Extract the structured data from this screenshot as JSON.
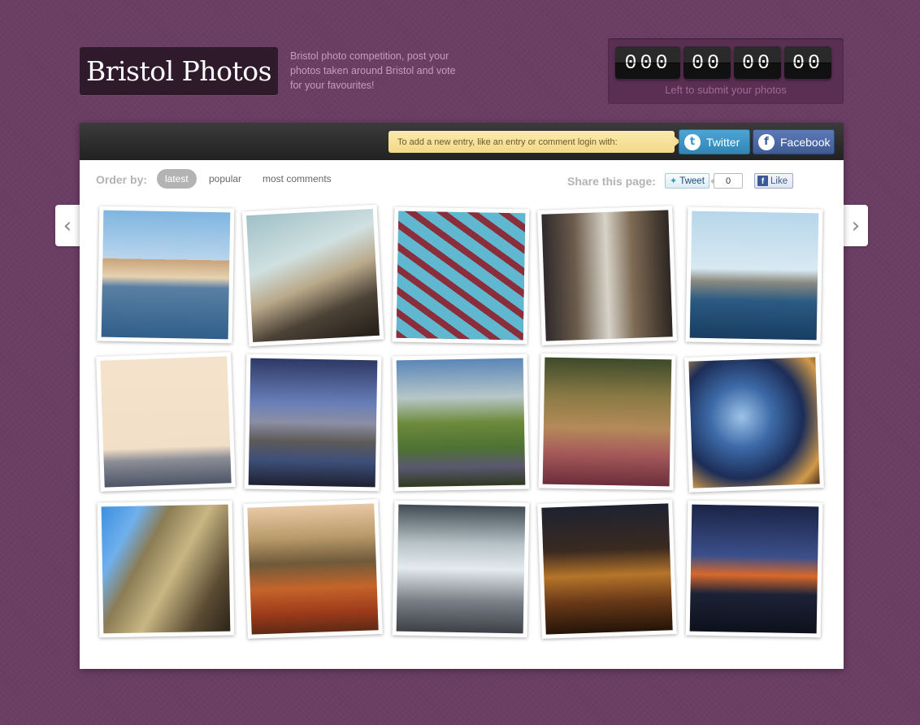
{
  "header": {
    "title": "Bristol Photos",
    "tagline": "Bristol photo competition, post your photos taken around Bristol and vote for your favourites!"
  },
  "countdown": {
    "segments": [
      "000",
      "00",
      "00",
      "00"
    ],
    "caption": "Left to submit your photos"
  },
  "toolbar": {
    "login_hint": "To add a new entry, like an entry or comment login with:",
    "twitter_label": "Twitter",
    "facebook_label": "Facebook"
  },
  "order": {
    "label": "Order by:",
    "options": [
      "latest",
      "popular",
      "most comments"
    ],
    "active": "latest"
  },
  "share": {
    "label": "Share this page:",
    "tweet_label": "Tweet",
    "tweet_count": "0",
    "like_label": "Like"
  },
  "colors": {
    "background": "#6b3d64",
    "twitter": "#3596c9",
    "facebook": "#3e5a97"
  },
  "photos": [
    {
      "subject": "harbourside colourful houses"
    },
    {
      "subject": "suspension bridge tower"
    },
    {
      "subject": "red iron bridge walkway"
    },
    {
      "subject": "old street with buildings"
    },
    {
      "subject": "marina boats"
    },
    {
      "subject": "pale sky over hillside houses"
    },
    {
      "subject": "gorge with suspension bridge, stormy sky"
    },
    {
      "subject": "gorge and river from above"
    },
    {
      "subject": "autumn leaves on path"
    },
    {
      "subject": "glass building architecture"
    },
    {
      "subject": "university tower facade"
    },
    {
      "subject": "autumn tree avenue"
    },
    {
      "subject": "train station interior"
    },
    {
      "subject": "city lights at night"
    },
    {
      "subject": "suspension bridge at dusk"
    }
  ]
}
